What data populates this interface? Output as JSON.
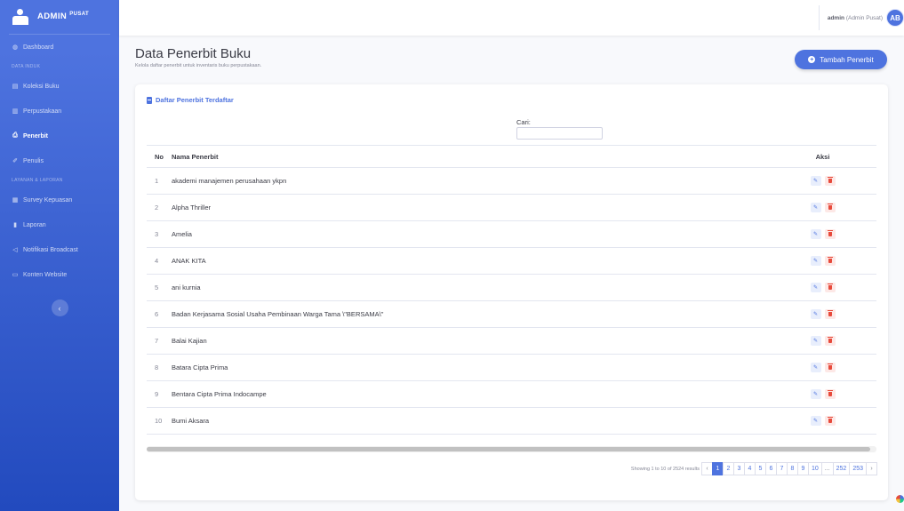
{
  "brand": {
    "title": "ADMIN",
    "suffix": "PUSAT",
    "logo_icon": "user-group-icon"
  },
  "sidebar": {
    "items": [
      {
        "label": "Dashboard",
        "icon": "gauge-icon",
        "glyph": "◍",
        "active": false
      },
      {
        "heading": "DATA INDUK"
      },
      {
        "label": "Koleksi Buku",
        "icon": "book-list-icon",
        "glyph": "▤",
        "active": false
      },
      {
        "label": "Perpustakaan",
        "icon": "building-icon",
        "glyph": "▥",
        "active": false
      },
      {
        "label": "Penerbit",
        "icon": "print-icon",
        "glyph": "⎙",
        "active": true
      },
      {
        "label": "Penulis",
        "icon": "pen-icon",
        "glyph": "✐",
        "active": false
      },
      {
        "heading": "LAYANAN & LAPORAN"
      },
      {
        "label": "Survey Kepuasan",
        "icon": "clipboard-icon",
        "glyph": "▦",
        "active": false
      },
      {
        "label": "Laporan",
        "icon": "chart-icon",
        "glyph": "▮",
        "active": false
      },
      {
        "label": "Notifikasi Broadcast",
        "icon": "megaphone-icon",
        "glyph": "◁",
        "active": false
      },
      {
        "label": "Konten Website",
        "icon": "window-icon",
        "glyph": "▭",
        "active": false
      }
    ],
    "toggle_glyph": "‹"
  },
  "topbar": {
    "user_name": "admin",
    "user_role": "(Admin Pusat)",
    "avatar_initials": "AB"
  },
  "page": {
    "title": "Data Penerbit Buku",
    "subtitle": "Kelola daftar penerbit untuk inventaris buku perpustakaan.",
    "add_button": "Tambah Penerbit"
  },
  "card": {
    "title": "Daftar Penerbit Terdaftar",
    "search_label": "Cari:",
    "search_value": ""
  },
  "table": {
    "headers": {
      "no": "No",
      "name": "Nama Penerbit",
      "actions": "Aksi"
    },
    "rows": [
      {
        "no": "1",
        "name": "akademi manajemen perusahaan ykpn"
      },
      {
        "no": "2",
        "name": "Alpha Thriller"
      },
      {
        "no": "3",
        "name": "Amelia"
      },
      {
        "no": "4",
        "name": "ANAK KITA"
      },
      {
        "no": "5",
        "name": "ani kurnia"
      },
      {
        "no": "6",
        "name": "Badan Kerjasama Sosial Usaha Pembinaan Warga Tama \\\"BERSAMA\\\""
      },
      {
        "no": "7",
        "name": "Balai Kajian"
      },
      {
        "no": "8",
        "name": "Batara Cipta Prima"
      },
      {
        "no": "9",
        "name": "Bentara Cipta Prima Indocampe"
      },
      {
        "no": "10",
        "name": "Bumi Aksara"
      }
    ],
    "edit_icon": "edit-icon",
    "delete_icon": "trash-icon"
  },
  "pagination": {
    "info": "Showing 1 to 10 of 2524 results",
    "prev": "‹",
    "pages": [
      "1",
      "2",
      "3",
      "4",
      "5",
      "6",
      "7",
      "8",
      "9",
      "10",
      "...",
      "252",
      "253"
    ],
    "current": "1",
    "next": "›"
  },
  "colors": {
    "primary": "#4e73df",
    "danger": "#e74a3b"
  }
}
